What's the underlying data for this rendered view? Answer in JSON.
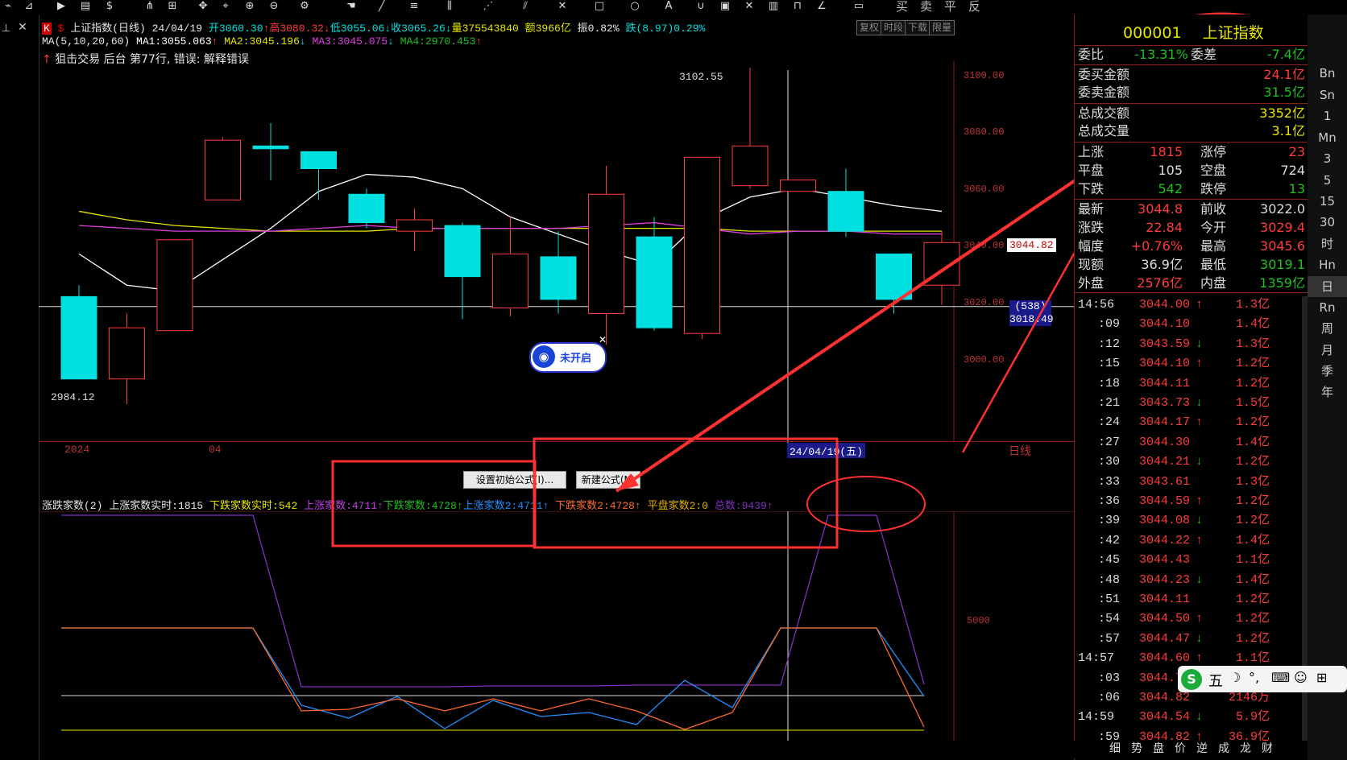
{
  "toolbar": {
    "right_labels": [
      "买",
      "卖",
      "平",
      "反"
    ]
  },
  "header": {
    "k_badge": "K",
    "title": "上证指数(日线)",
    "date": "24/04/19",
    "open": "开3060.30",
    "high": "高3080.32",
    "low": "低3055.06",
    "close": "收3065.26",
    "volume": "量375543840",
    "amount": "额3966亿",
    "amplitude": "振0.82%",
    "change": "跌(8.97)0.29%",
    "buttons": [
      "复权",
      "时段",
      "下载",
      "限量"
    ]
  },
  "ma": {
    "label": "MA(5,10,20,60)",
    "ma1": "MA1:3055.063",
    "ma2": "MA2:3045.196",
    "ma3": "MA3:3045.075",
    "ma4": "MA4:2970.453"
  },
  "formula_status": "狙击交易 后台  第77行, 错误: 解释错误",
  "chart": {
    "y_labels": [
      "3100.00",
      "3080.00",
      "3060.00",
      "3040.00",
      "3020.00",
      "3000.00"
    ],
    "high_label": "3102.55",
    "low_label": "2984.12",
    "current_price_tag": "3044.82",
    "cursor_tag_top": "(538)",
    "cursor_tag_bottom": "3018.49",
    "x_labels": [
      "2024",
      "04"
    ],
    "cursor_date": "24/04/19(五)",
    "period": "日线",
    "not_open_label": "未开启"
  },
  "chart_data": {
    "type": "candlestick",
    "title": "上证指数(日线)",
    "ylim": [
      2980,
      3105
    ],
    "candles": [
      {
        "o": 3022,
        "c": 2993,
        "h": 3026,
        "l": 2993
      },
      {
        "o": 2993,
        "c": 3011,
        "h": 3016,
        "l": 2984.12
      },
      {
        "o": 3010,
        "c": 3042,
        "h": 3042,
        "l": 3010
      },
      {
        "o": 3056,
        "c": 3077,
        "h": 3078,
        "l": 3056
      },
      {
        "o": 3075,
        "c": 3074,
        "h": 3083,
        "l": 3063
      },
      {
        "o": 3073,
        "c": 3067,
        "h": 3073,
        "l": 3056
      },
      {
        "o": 3058,
        "c": 3048,
        "h": 3060,
        "l": 3046
      },
      {
        "o": 3045,
        "c": 3049,
        "h": 3053,
        "l": 3038
      },
      {
        "o": 3047,
        "c": 3029,
        "h": 3048,
        "l": 3014
      },
      {
        "o": 3018,
        "c": 3037,
        "h": 3050,
        "l": 3015
      },
      {
        "o": 3036,
        "c": 3021,
        "h": 3045,
        "l": 3016
      },
      {
        "o": 3016,
        "c": 3058,
        "h": 3068,
        "l": 3005
      },
      {
        "o": 3043,
        "c": 3011,
        "h": 3050,
        "l": 3010
      },
      {
        "o": 3009,
        "c": 3071,
        "h": 3071,
        "l": 3007
      },
      {
        "o": 3061,
        "c": 3075,
        "h": 3102.55,
        "l": 3060
      },
      {
        "o": 3059,
        "c": 3063,
        "h": 3063,
        "l": 3059
      },
      {
        "o": 3059,
        "c": 3045,
        "h": 3067,
        "l": 3043
      },
      {
        "o": 3037,
        "c": 3021,
        "h": 3037,
        "l": 3016
      },
      {
        "o": 3026,
        "c": 3041,
        "h": 3045,
        "l": 3019
      }
    ],
    "ma_lines": [
      {
        "name": "MA1",
        "values": [
          3037,
          3026,
          3024,
          3035,
          3046,
          3059,
          3065,
          3064,
          3060,
          3050,
          3044,
          3038,
          3033,
          3049,
          3057,
          3060,
          3057,
          3054,
          3052
        ]
      },
      {
        "name": "MA2",
        "values": [
          3052,
          3049,
          3047,
          3046,
          3045,
          3045,
          3045,
          3046,
          3046,
          3046,
          3046,
          3046,
          3046,
          3046,
          3045,
          3045,
          3045,
          3045,
          3045
        ]
      },
      {
        "name": "MA3",
        "values": [
          3047,
          3046,
          3045,
          3045,
          3045,
          3046,
          3047,
          3046,
          3046,
          3046,
          3046,
          3047,
          3048,
          3046,
          3044,
          3045,
          3045,
          3044,
          3044
        ]
      }
    ]
  },
  "indicator": {
    "name": "涨跌家数(2)",
    "up_realtime": "上涨家数实时:1815",
    "down_realtime": "下跌家数实时:542",
    "up": "上涨家数:4711",
    "down": "下跌家数:4728",
    "up2": "上涨家数2:4711",
    "down2": "下跌家数2:4728",
    "flat2": "平盘家数2:0",
    "total": "总数:9439",
    "y_label": "5000",
    "btn_reset": "设置初始公式(I)...",
    "btn_new": "新建公式(N)"
  },
  "quote": {
    "code": "000001",
    "name": "上证指数",
    "weibi_label": "委比",
    "weibi": "-13.31%",
    "weicha_label": "委差",
    "weicha": "-7.4亿",
    "buy_amt_label": "委买金额",
    "buy_amt": "24.1亿",
    "sell_amt_label": "委卖金额",
    "sell_amt": "31.5亿",
    "total_amt_label": "总成交额",
    "total_amt": "3352亿",
    "total_vol_label": "总成交量",
    "total_vol": "3.1亿",
    "stats": [
      [
        "上涨",
        "1815",
        "涨停",
        "23"
      ],
      [
        "平盘",
        "105",
        "空盘",
        "724"
      ],
      [
        "下跌",
        "542",
        "跌停",
        "13"
      ]
    ],
    "prices": [
      [
        "最新",
        "3044.8",
        "前收",
        "3022.0"
      ],
      [
        "涨跌",
        "22.84",
        "今开",
        "3029.4"
      ],
      [
        "幅度",
        "+0.76%",
        "最高",
        "3045.6"
      ],
      [
        "现额",
        "36.9亿",
        "最低",
        "3019.1"
      ],
      [
        "外盘",
        "2576亿",
        "内盘",
        "1359亿"
      ]
    ]
  },
  "ticks": [
    {
      "t": "14:56",
      "p": "3044.00",
      "d": "↑",
      "v": "1.3亿"
    },
    {
      "t": ":09",
      "p": "3044.10",
      "d": "",
      "v": "1.4亿"
    },
    {
      "t": ":12",
      "p": "3043.59",
      "d": "↓",
      "v": "1.3亿"
    },
    {
      "t": ":15",
      "p": "3044.10",
      "d": "↑",
      "v": "1.2亿"
    },
    {
      "t": ":18",
      "p": "3044.11",
      "d": "",
      "v": "1.2亿"
    },
    {
      "t": ":21",
      "p": "3043.73",
      "d": "↓",
      "v": "1.5亿"
    },
    {
      "t": ":24",
      "p": "3044.17",
      "d": "↑",
      "v": "1.2亿"
    },
    {
      "t": ":27",
      "p": "3044.30",
      "d": "",
      "v": "1.4亿"
    },
    {
      "t": ":30",
      "p": "3044.21",
      "d": "↓",
      "v": "1.2亿"
    },
    {
      "t": ":33",
      "p": "3043.61",
      "d": "",
      "v": "1.3亿"
    },
    {
      "t": ":36",
      "p": "3044.59",
      "d": "↑",
      "v": "1.2亿"
    },
    {
      "t": ":39",
      "p": "3044.08",
      "d": "↓",
      "v": "1.2亿"
    },
    {
      "t": ":42",
      "p": "3044.22",
      "d": "↑",
      "v": "1.4亿"
    },
    {
      "t": ":45",
      "p": "3044.43",
      "d": "",
      "v": "1.1亿"
    },
    {
      "t": ":48",
      "p": "3044.23",
      "d": "↓",
      "v": "1.4亿"
    },
    {
      "t": ":51",
      "p": "3044.11",
      "d": "",
      "v": "1.2亿"
    },
    {
      "t": ":54",
      "p": "3044.50",
      "d": "↑",
      "v": "1.2亿"
    },
    {
      "t": ":57",
      "p": "3044.47",
      "d": "↓",
      "v": "1.2亿"
    },
    {
      "t": "14:57",
      "p": "3044.60",
      "d": "↑",
      "v": "1.1亿"
    },
    {
      "t": ":03",
      "p": "3044.75",
      "d": "",
      "v": ""
    },
    {
      "t": ":06",
      "p": "3044.82",
      "d": "",
      "v": "2146万"
    },
    {
      "t": "14:59",
      "p": "3044.54",
      "d": "↓",
      "v": "5.9亿"
    },
    {
      "t": ":59",
      "p": "3044.82",
      "d": "↑",
      "v": "36.9亿"
    }
  ],
  "bottom_tabs": [
    "细",
    "势",
    "盘",
    "价",
    "逆",
    "成",
    "龙",
    "财"
  ],
  "far_right_items": [
    "Bn",
    "Sn",
    "1",
    "Mn",
    "3",
    "5",
    "15",
    "30",
    "时",
    "Hn",
    "日",
    "Rn",
    "周",
    "月",
    "季",
    "年"
  ],
  "ime": {
    "label": "五"
  },
  "colors": {
    "up": "#ff3c3c",
    "down": "#00e0e0",
    "ma1": "#ffffff",
    "ma2": "#e6e600",
    "ma3": "#e040e0",
    "grid": "#8a1c1c",
    "annotation": "#ff3030"
  }
}
